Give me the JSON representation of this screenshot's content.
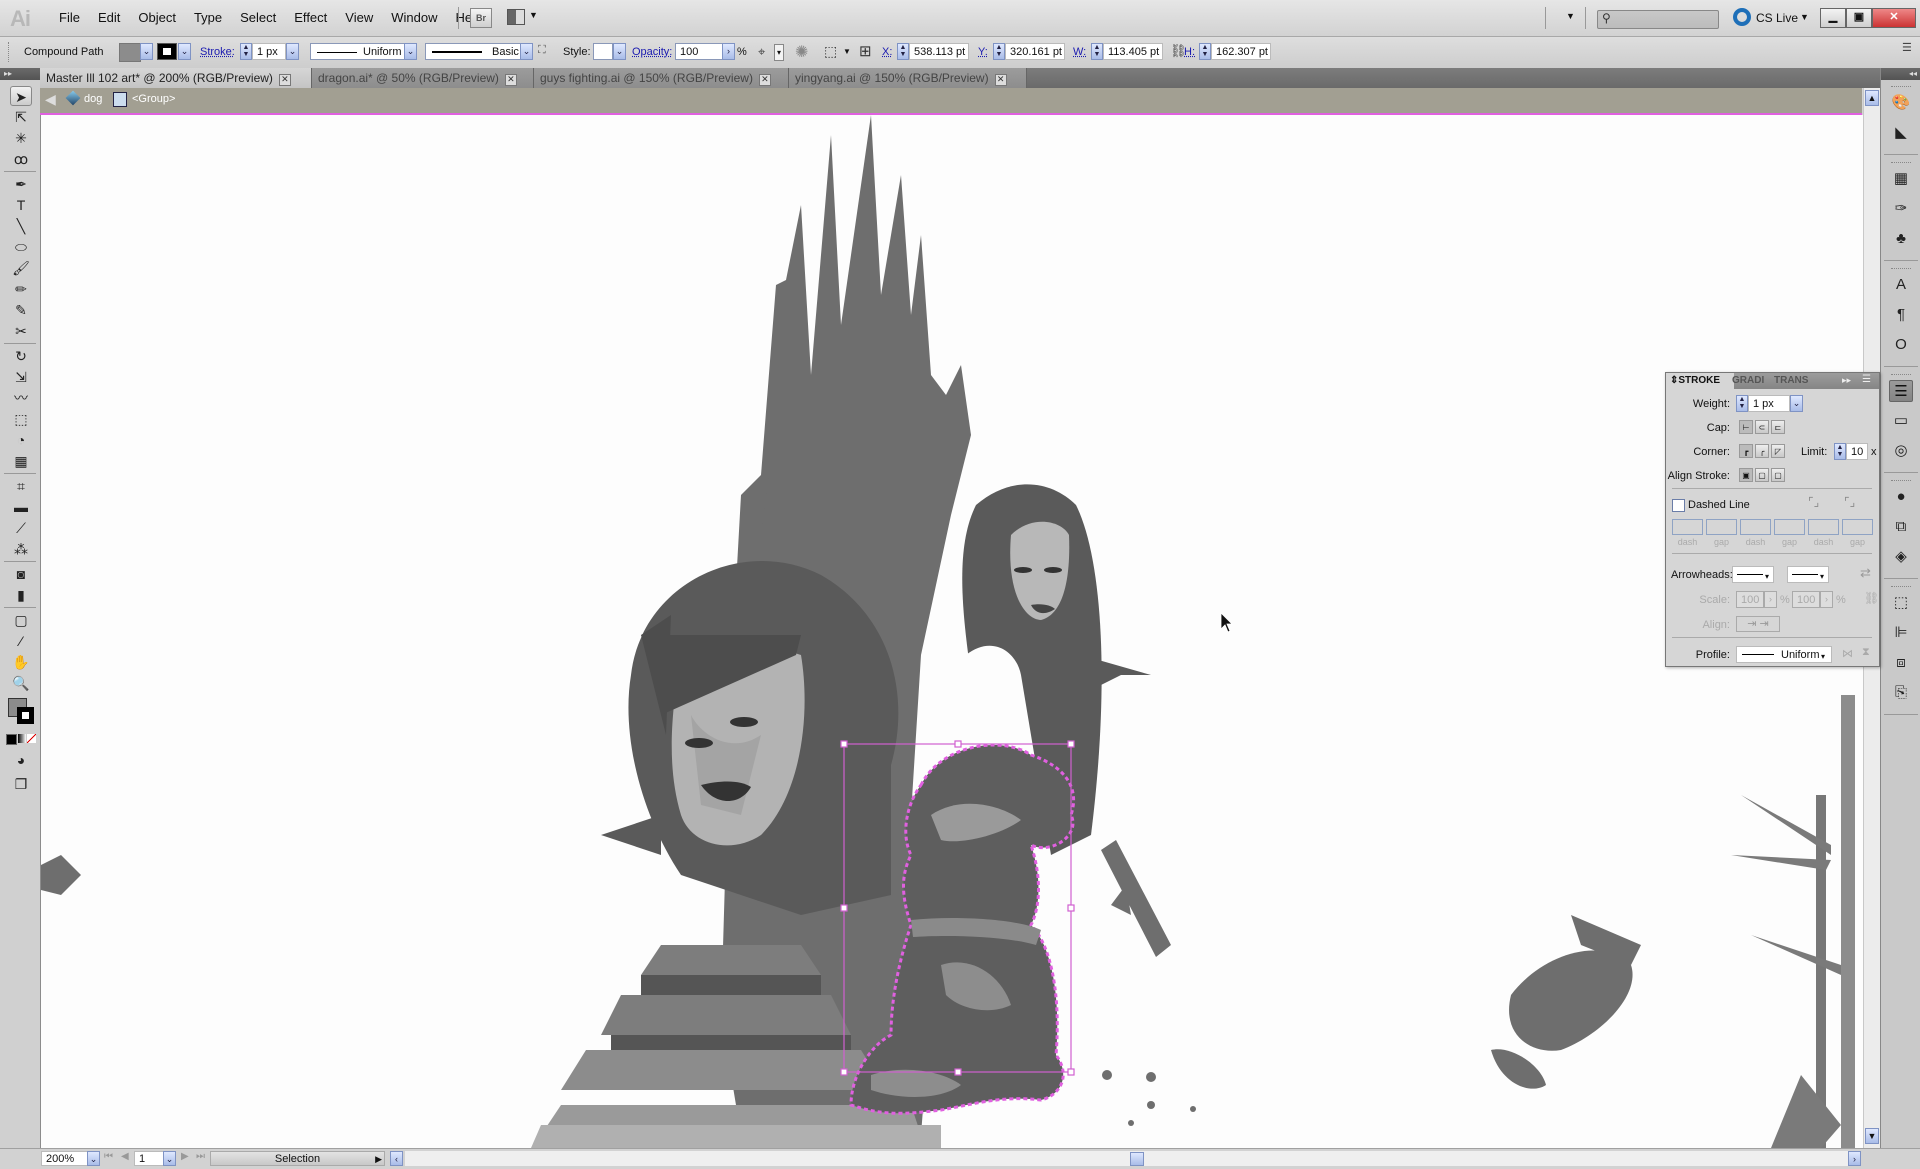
{
  "app": {
    "logo": "Ai",
    "menu": [
      "File",
      "Edit",
      "Object",
      "Type",
      "Select",
      "Effect",
      "View",
      "Window",
      "Help"
    ],
    "bridge_label": "Br",
    "cs_live": "CS Live",
    "search_placeholder": ""
  },
  "control_bar": {
    "selection_type": "Compound Path",
    "fill_color": "#8c8c8c",
    "stroke_color": "#000000",
    "stroke_label": "Stroke:",
    "stroke_weight": "1 px",
    "variable_width_profile": "Uniform",
    "brush_definition": "Basic",
    "style_label": "Style:",
    "opacity_label": "Opacity:",
    "opacity_value": "100",
    "opacity_unit": "%",
    "x_label": "X:",
    "x_value": "538.113 pt",
    "y_label": "Y:",
    "y_value": "320.161 pt",
    "w_label": "W:",
    "w_value": "113.405 pt",
    "h_label": "H:",
    "h_value": "162.307 pt"
  },
  "tabs": [
    {
      "label": "Master Ill 102 art* @ 200% (RGB/Preview)",
      "active": true
    },
    {
      "label": "dragon.ai* @ 50% (RGB/Preview)",
      "active": false
    },
    {
      "label": "guys fighting.ai @ 150% (RGB/Preview)",
      "active": false
    },
    {
      "label": "yingyang.ai @ 150% (RGB/Preview)",
      "active": false
    }
  ],
  "breadcrumb": {
    "layer": "dog",
    "group": "<Group>"
  },
  "toolbar": {
    "tools": [
      {
        "name": "selection-tool",
        "glyph": "➤",
        "selected": true
      },
      {
        "name": "direct-selection-tool",
        "glyph": "⇱"
      },
      {
        "name": "magic-wand-tool",
        "glyph": "✳"
      },
      {
        "name": "lasso-tool",
        "glyph": "ꝏ"
      },
      {
        "name": "pen-tool",
        "glyph": "✒"
      },
      {
        "name": "type-tool",
        "glyph": "T"
      },
      {
        "name": "line-segment-tool",
        "glyph": "╲"
      },
      {
        "name": "ellipse-tool",
        "glyph": "⬭"
      },
      {
        "name": "paintbrush-tool",
        "glyph": "🖌"
      },
      {
        "name": "pencil-tool",
        "glyph": "✏"
      },
      {
        "name": "blob-brush-tool",
        "glyph": "✎"
      },
      {
        "name": "scissors-tool",
        "glyph": "✂"
      },
      {
        "name": "rotate-tool",
        "glyph": "↻"
      },
      {
        "name": "scale-tool",
        "glyph": "⇲"
      },
      {
        "name": "warp-tool",
        "glyph": "〰"
      },
      {
        "name": "free-transform-tool",
        "glyph": "⬚"
      },
      {
        "name": "shape-builder-tool",
        "glyph": "◔"
      },
      {
        "name": "perspective-grid-tool",
        "glyph": "▦"
      },
      {
        "name": "mesh-tool",
        "glyph": "⌗"
      },
      {
        "name": "gradient-tool",
        "glyph": "▬"
      },
      {
        "name": "eyedropper-tool",
        "glyph": "⟋"
      },
      {
        "name": "blend-tool",
        "glyph": "⁂"
      },
      {
        "name": "symbol-sprayer-tool",
        "glyph": "◙"
      },
      {
        "name": "column-graph-tool",
        "glyph": "▮"
      },
      {
        "name": "artboard-tool",
        "glyph": "▢"
      },
      {
        "name": "slice-tool",
        "glyph": "⁄"
      },
      {
        "name": "hand-tool",
        "glyph": "✋"
      },
      {
        "name": "zoom-tool",
        "glyph": "🔍"
      }
    ],
    "fill_color": "#8c8c8c",
    "stroke_color": "#000000"
  },
  "dock": {
    "icons": [
      "color-panel-icon",
      "color-guide-icon",
      "swatches-icon",
      "brushes-icon",
      "symbols-icon",
      "character-icon",
      "paragraph-icon",
      "opentype-icon",
      "stroke-icon",
      "gradient-icon",
      "transparency-icon",
      "appearance-icon",
      "graphic-styles-icon",
      "layers-icon",
      "transform-icon",
      "align-icon",
      "pathfinder-icon",
      "artboards-icon"
    ]
  },
  "stroke_panel": {
    "tabs": [
      "STROKE",
      "GRADI",
      "TRANS"
    ],
    "weight_label": "Weight:",
    "weight_value": "1 px",
    "cap_label": "Cap:",
    "corner_label": "Corner:",
    "limit_label": "Limit:",
    "limit_value": "10",
    "limit_unit": "x",
    "align_stroke_label": "Align Stroke:",
    "dashed_line_label": "Dashed Line",
    "dashed_line_checked": false,
    "dash_labels": [
      "dash",
      "gap",
      "dash",
      "gap",
      "dash",
      "gap"
    ],
    "arrowheads_label": "Arrowheads:",
    "scale_label": "Scale:",
    "scale_start": "100",
    "scale_end": "100",
    "scale_unit": "%",
    "align_label": "Align:",
    "profile_label": "Profile:",
    "profile_value": "Uniform"
  },
  "status_bar": {
    "zoom": "200%",
    "artboard": "1",
    "current_tool": "Selection"
  },
  "selection": {
    "highlight_color": "#e060e0"
  }
}
